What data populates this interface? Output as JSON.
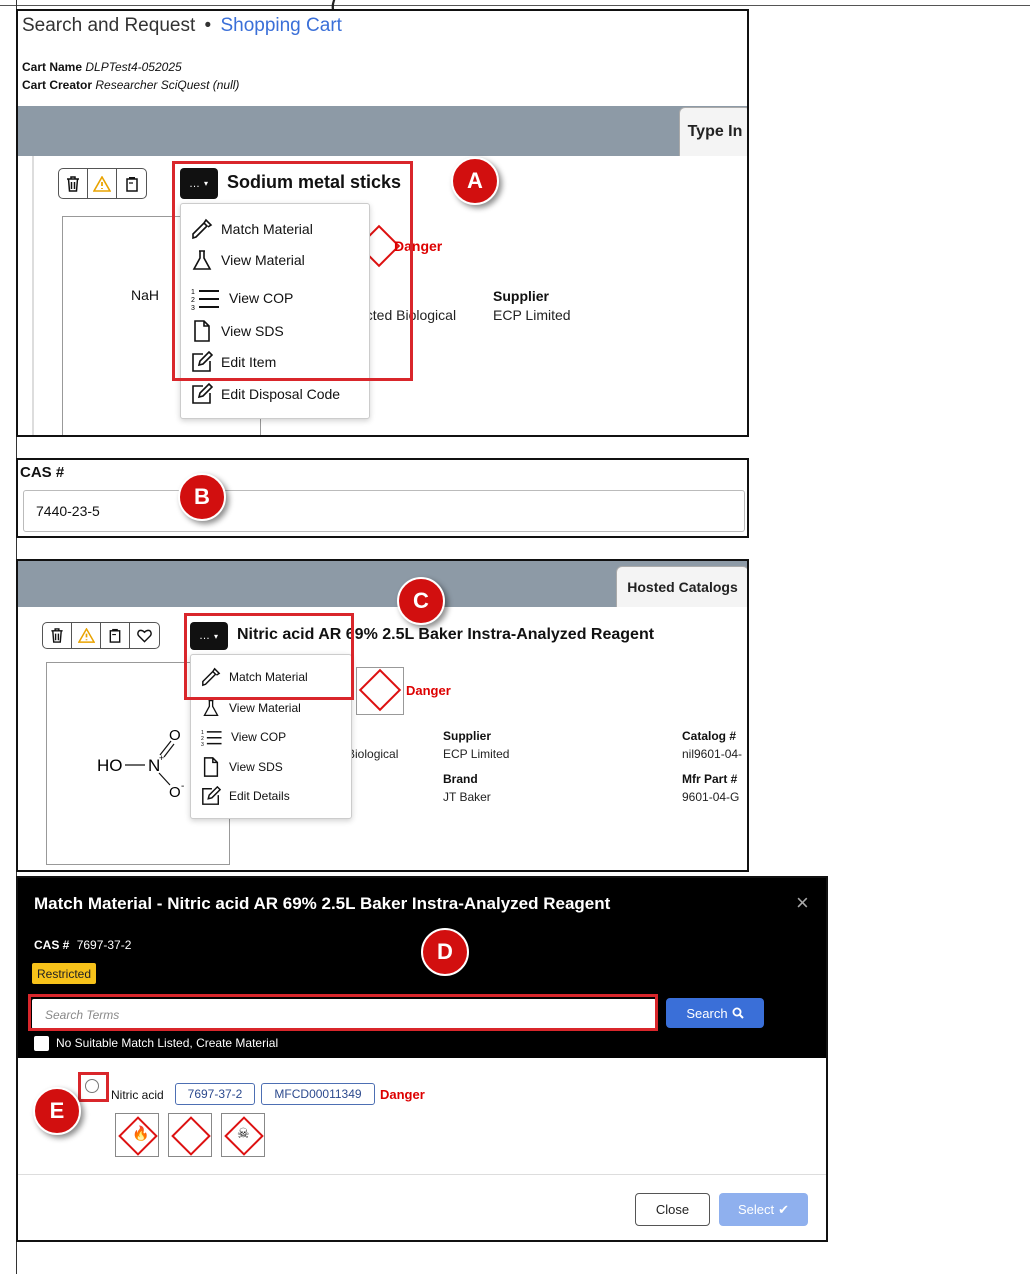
{
  "header": {
    "breadcrumb_root": "Search and Request",
    "breadcrumb_sep": "•",
    "breadcrumb_current": "Shopping Cart",
    "cart_name_label": "Cart Name",
    "cart_name_value": "DLPTest4-052025",
    "cart_creator_label": "Cart Creator",
    "cart_creator_value": "Researcher SciQuest (null)"
  },
  "panel_a": {
    "tab_label": "Type In",
    "item_title": "Sodium metal sticks",
    "menu_button": "…",
    "formula": "NaH",
    "danger": "Danger",
    "restricted_partial": "ricted Biological",
    "supplier_label": "Supplier",
    "supplier_value": "ECP Limited",
    "menu": [
      {
        "label": "Match Material",
        "icon": "pipette-icon"
      },
      {
        "label": "View Material",
        "icon": "flask-icon"
      },
      {
        "label": "View COP",
        "icon": "numbered-list-icon"
      },
      {
        "label": "View SDS",
        "icon": "document-icon"
      },
      {
        "label": "Edit Item",
        "icon": "edit-icon"
      },
      {
        "label": "Edit Disposal Code",
        "icon": "edit-icon"
      }
    ],
    "callout": "A"
  },
  "panel_b": {
    "cas_label": "CAS #",
    "cas_value": "7440-23-5",
    "callout": "B"
  },
  "panel_c": {
    "tab_label": "Hosted Catalogs",
    "item_title": "Nitric acid AR 69% 2.5L Baker Instra-Analyzed Reagent",
    "menu_button": "…",
    "danger": "Danger",
    "restricted_partial": "d Biological",
    "supplier_label": "Supplier",
    "supplier_value": "ECP Limited",
    "brand_label": "Brand",
    "brand_value": "JT Baker",
    "catalog_label": "Catalog #",
    "catalog_value": "nil9601-04-",
    "mfr_label": "Mfr Part #",
    "mfr_value": "9601-04-G",
    "menu": [
      {
        "label": "Match Material",
        "icon": "pipette-icon"
      },
      {
        "label": "View Material",
        "icon": "flask-icon"
      },
      {
        "label": "View COP",
        "icon": "numbered-list-icon"
      },
      {
        "label": "View SDS",
        "icon": "document-icon"
      },
      {
        "label": "Edit Details",
        "icon": "edit-icon"
      }
    ],
    "callout": "C"
  },
  "dialog": {
    "title": "Match Material - Nitric acid AR 69% 2.5L Baker Instra-Analyzed Reagent",
    "cas_label": "CAS #",
    "cas_value": "7697-37-2",
    "restricted_badge": "Restricted",
    "search_placeholder": "Search Terms",
    "search_button": "Search",
    "no_match_label": "No Suitable Match Listed, Create Material",
    "result_name": "Nitric acid",
    "result_cas": "7697-37-2",
    "result_mfcd": "MFCD00011349",
    "result_danger": "Danger",
    "close_button": "Close",
    "select_button": "Select",
    "callout_d": "D",
    "callout_e": "E",
    "close_x": "×"
  },
  "colors": {
    "accent_blue": "#3a6fd8",
    "danger_red": "#d00000",
    "callout_red": "#d20f0f",
    "restricted_yellow": "#f7c21a",
    "bar_gray": "#8d9aa6"
  }
}
